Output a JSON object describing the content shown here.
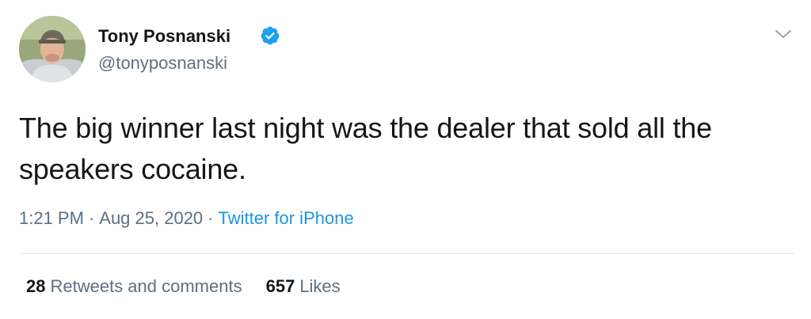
{
  "author": {
    "display_name": "Tony Posnanski",
    "handle": "@tonyposnanski",
    "verified": true,
    "avatar": "profile-photo"
  },
  "tweet": {
    "text": "The big winner last night was the dealer that sold all the speakers cocaine."
  },
  "meta": {
    "time": "1:21 PM",
    "separator": "·",
    "date": "Aug 25, 2020",
    "source": "Twitter for iPhone"
  },
  "stats": {
    "retweets_count": "28",
    "retweets_label": "Retweets and comments",
    "likes_count": "657",
    "likes_label": "Likes"
  },
  "icons": {
    "verified": "verified-badge-icon",
    "menu": "chevron-down-icon"
  },
  "colors": {
    "text": "#14171a",
    "secondary": "#5b7083",
    "link": "#1b95e0",
    "verified": "#1da1f2",
    "divider": "#e1e8ed"
  }
}
